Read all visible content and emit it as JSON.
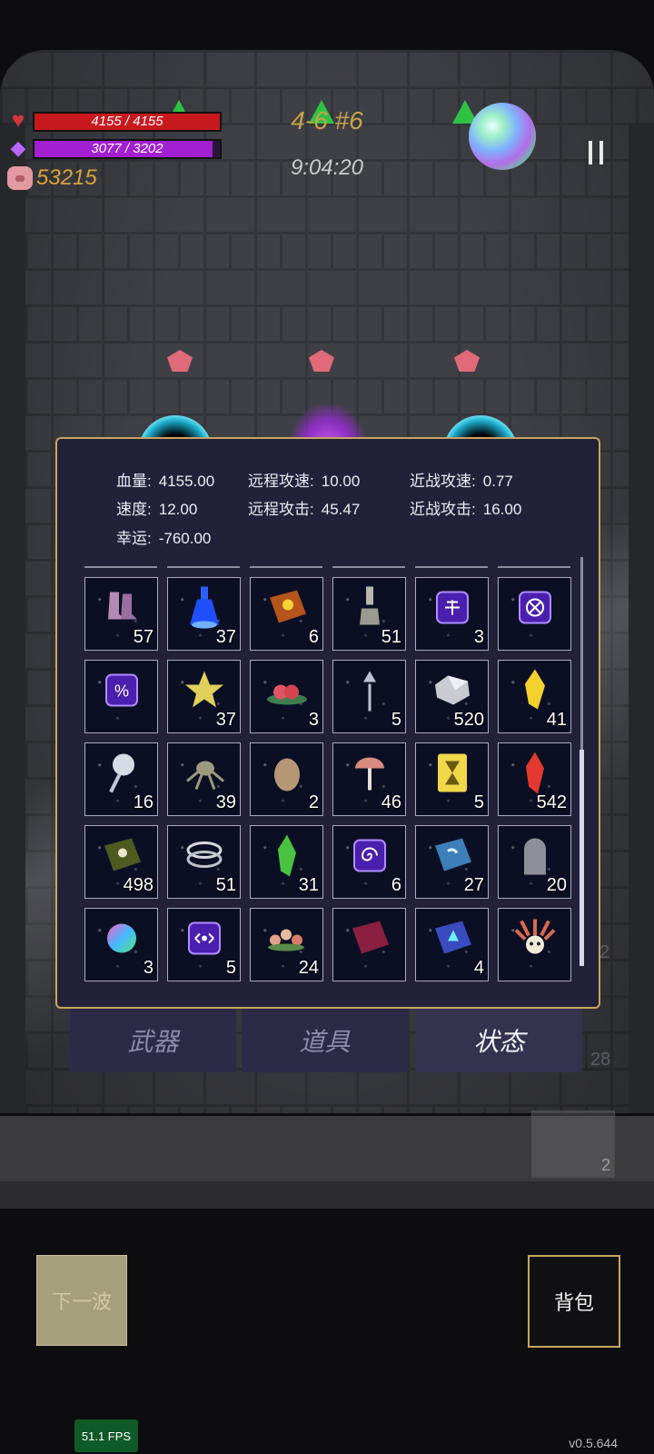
{
  "hud": {
    "hp_text": "4155 / 4155",
    "hp_fraction": 1.0,
    "mana_text": "3077 / 3202",
    "mana_fraction": 0.96,
    "coins": "53215",
    "level": "4-6 #6",
    "timer": "9:04:20"
  },
  "stats": {
    "hp_label": "血量:",
    "hp_value": "4155.00",
    "ranged_speed_label": "远程攻速:",
    "ranged_speed_value": "10.00",
    "melee_speed_label": "近战攻速:",
    "melee_speed_value": "0.77",
    "speed_label": "速度:",
    "speed_value": "12.00",
    "ranged_attack_label": "远程攻击:",
    "ranged_attack_value": "45.47",
    "melee_attack_label": "近战攻击:",
    "melee_attack_value": "16.00",
    "luck_label": "幸运:",
    "luck_value": "-760.00"
  },
  "items": [
    {
      "icon": "boots-icon",
      "qty": "57"
    },
    {
      "icon": "blue-potion-icon",
      "qty": "37"
    },
    {
      "icon": "spellbook-orange-icon",
      "qty": "6"
    },
    {
      "icon": "flask-icon",
      "qty": "51"
    },
    {
      "icon": "rune-tile-icon",
      "qty": "3"
    },
    {
      "icon": "rune-cross-icon",
      "qty": ""
    },
    {
      "icon": "rune-percent-icon",
      "qty": ""
    },
    {
      "icon": "star-crystal-icon",
      "qty": "37"
    },
    {
      "icon": "red-flower-icon",
      "qty": "3"
    },
    {
      "icon": "cane-icon",
      "qty": "5"
    },
    {
      "icon": "silver-ore-icon",
      "qty": "520"
    },
    {
      "icon": "yellow-crystal-icon",
      "qty": "41"
    },
    {
      "icon": "silver-flower-icon",
      "qty": "16"
    },
    {
      "icon": "squid-icon",
      "qty": "39"
    },
    {
      "icon": "egg-icon",
      "qty": "2"
    },
    {
      "icon": "mushroom-icon",
      "qty": "46"
    },
    {
      "icon": "hourglass-card-icon",
      "qty": "5"
    },
    {
      "icon": "red-crystal-icon",
      "qty": "542"
    },
    {
      "icon": "green-book-icon",
      "qty": "498"
    },
    {
      "icon": "rings-icon",
      "qty": "51"
    },
    {
      "icon": "green-crystal-icon",
      "qty": "31"
    },
    {
      "icon": "rune-spiral-icon",
      "qty": "6"
    },
    {
      "icon": "blue-book-icon",
      "qty": "27"
    },
    {
      "icon": "tombstone-icon",
      "qty": "20"
    },
    {
      "icon": "rainbow-orb-icon",
      "qty": "3"
    },
    {
      "icon": "rune-eye-icon",
      "qty": "5"
    },
    {
      "icon": "flower-wreath-icon",
      "qty": "24"
    },
    {
      "icon": "purple-book-icon",
      "qty": ""
    },
    {
      "icon": "triangle-book-icon",
      "qty": "4"
    },
    {
      "icon": "feather-skull-icon",
      "qty": ""
    }
  ],
  "tabs": {
    "weapons": "武器",
    "items": "道具",
    "status": "状态",
    "active": "status"
  },
  "side_numbers": {
    "right_2": "2",
    "right_28": "28",
    "box_qty": "2"
  },
  "buttons": {
    "next_wave": "下一波",
    "backpack": "背包"
  },
  "fps": "51.1 FPS",
  "version": "v0.5.644"
}
